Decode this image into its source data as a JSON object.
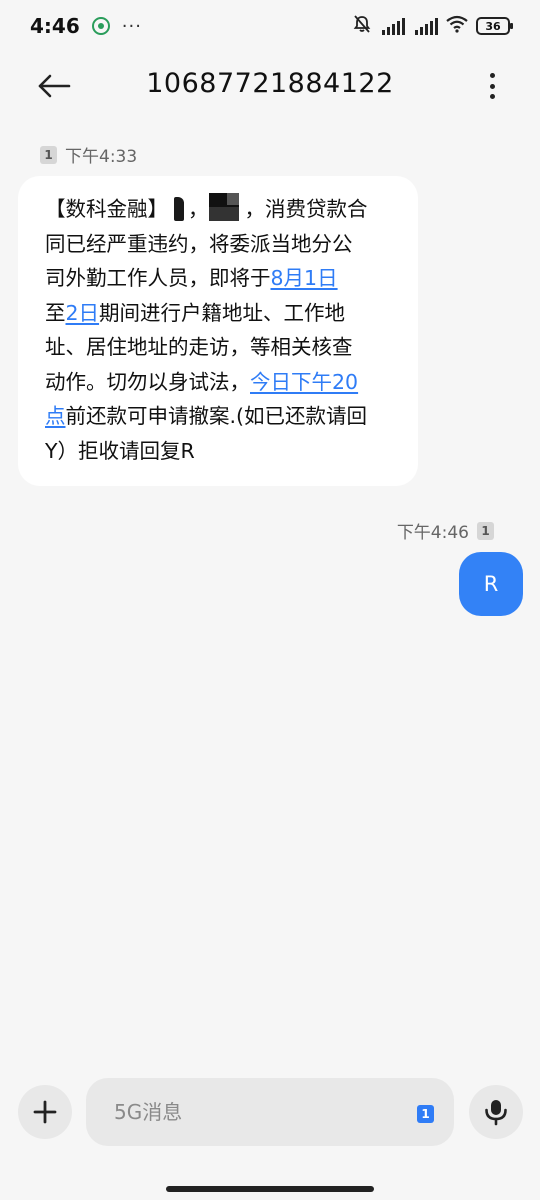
{
  "status_bar": {
    "time": "4:46",
    "more": "···",
    "battery": "36"
  },
  "header": {
    "title": "10687721884122"
  },
  "thread": {
    "incoming": {
      "sim": "1",
      "time": "下午4:33",
      "lines": {
        "l1_pre": "【数科金融】",
        "l1_comma": "，",
        "l1_post": "，消费贷款合",
        "l2": "同已经严重违约，将委派当地分公",
        "l3_pre": "司外勤工作人员，即将于",
        "l3_link": "8月1日",
        "l4_pre": "至",
        "l4_link": "2日",
        "l4_post": "期间进行户籍地址、工作地",
        "l5": "址、居住地址的走访，等相关核查",
        "l6_pre": "动作。切勿以身试法，",
        "l6_link": "今日下午20",
        "l7_link": "点",
        "l7_post": "前还款可申请撤案.(如已还款请回",
        "l8": "Y）拒收请回复R"
      }
    },
    "outgoing": {
      "sim": "1",
      "time": "下午4:46",
      "text": "R"
    }
  },
  "composer": {
    "placeholder": "5G消息",
    "sim": "1"
  }
}
